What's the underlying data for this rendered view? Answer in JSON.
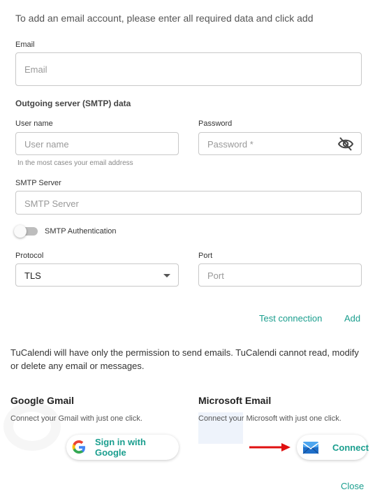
{
  "intro": "To add an email account, please enter all required data and click add",
  "email": {
    "label": "Email",
    "placeholder": "Email"
  },
  "smtp_section_title": "Outgoing server (SMTP) data",
  "username": {
    "label": "User name",
    "placeholder": "User name",
    "hint": "In the most cases your email address"
  },
  "password": {
    "label": "Password",
    "placeholder": "Password *"
  },
  "smtp_server": {
    "label": "SMTP Server",
    "placeholder": "SMTP Server"
  },
  "smtp_auth": {
    "label": "SMTP Authentication",
    "enabled": false
  },
  "protocol": {
    "label": "Protocol",
    "value": "TLS"
  },
  "port": {
    "label": "Port",
    "placeholder": "Port"
  },
  "actions": {
    "test_connection": "Test connection",
    "add": "Add"
  },
  "permission_note": "TuCalendi will have only the permission to send emails. TuCalendi cannot read, modify or delete any email or messages.",
  "google": {
    "title": "Google Gmail",
    "subtitle": "Connect your Gmail with just one click.",
    "button": "Sign in with Google"
  },
  "microsoft": {
    "title": "Microsoft Email",
    "subtitle": "Connect your Microsoft with just one click.",
    "button": "Connect"
  },
  "footer": {
    "close": "Close"
  },
  "colors": {
    "accent": "#1a9e8e",
    "arrow": "#e01010"
  }
}
